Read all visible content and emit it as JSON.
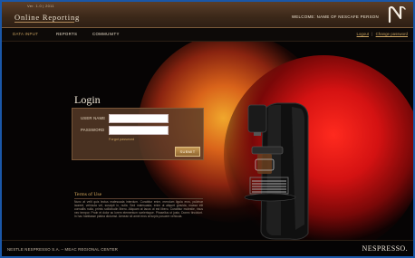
{
  "header": {
    "version": "Ver. 1.0 | 2011",
    "app_title": "Online Reporting",
    "welcome": "WELCOME: NAME OF NESCAFE PERSON"
  },
  "nav": {
    "items": [
      {
        "label": "DATA INPUT",
        "active": true
      },
      {
        "label": "REPORTS",
        "active": false
      },
      {
        "label": "COMMUNITY",
        "active": false
      }
    ],
    "logout": "Logout",
    "separator": "|",
    "change_password": "Change password"
  },
  "login": {
    "title": "Login",
    "username_label": "USER NAME",
    "username_value": "",
    "password_label": "PASSWORD",
    "password_value": "",
    "forgot": "Forgot password",
    "submit": "SUBMIT"
  },
  "terms": {
    "title": "Terms of Use",
    "text": "Nunc at velit quis lectus malesuada interdum. Curabitur enim, mendum ligula eros, pulvinar laoreet, vehicula vel, suscipit in, nulla. Sed malesuada, enim ut aliquet gravida, massa elit convallis nulla, primis sollicitudin libero. Aliquam at lacus ut est libero. Curabitur molestie, risus nec tempor. Proin et dolor ac lorem elementum scelerisque. Phasellus ut justo. Donec tincidunt. In hac habitasse platea dictumst. Aenean sit amet eros at turpis posuere vehicula."
  },
  "footer": {
    "text": "NESTLE NESPRESSO S.A. – MEAC REGIONAL CENTER",
    "brand": "NESPRESSO."
  },
  "colors": {
    "accent_gold": "#c9a260",
    "header_brown": "#3b2819",
    "background": "#0b0807"
  }
}
